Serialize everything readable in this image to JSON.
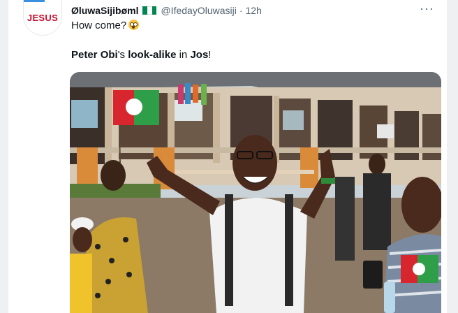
{
  "tweet": {
    "avatar_text": "JESUS",
    "display_name": "ØluwaSijibøml",
    "flag_colors": [
      "#008751",
      "#ffffff",
      "#008751"
    ],
    "handle": "@IfedayOluwasiji",
    "separator": "·",
    "time": "12h",
    "more_icon": "···",
    "text_line1": "How come?",
    "emoji": "flushed-face-emoji",
    "text_line2": {
      "part1": "Peter Obi",
      "part2": "'s ",
      "part3": "look-alike",
      "part4": " in ",
      "part5": "Jos",
      "part6": "!"
    },
    "photo": {
      "description_icon": "photo-image",
      "flag_colors": [
        "#d7262e",
        "#2e9e48",
        "#ffffff"
      ]
    }
  }
}
